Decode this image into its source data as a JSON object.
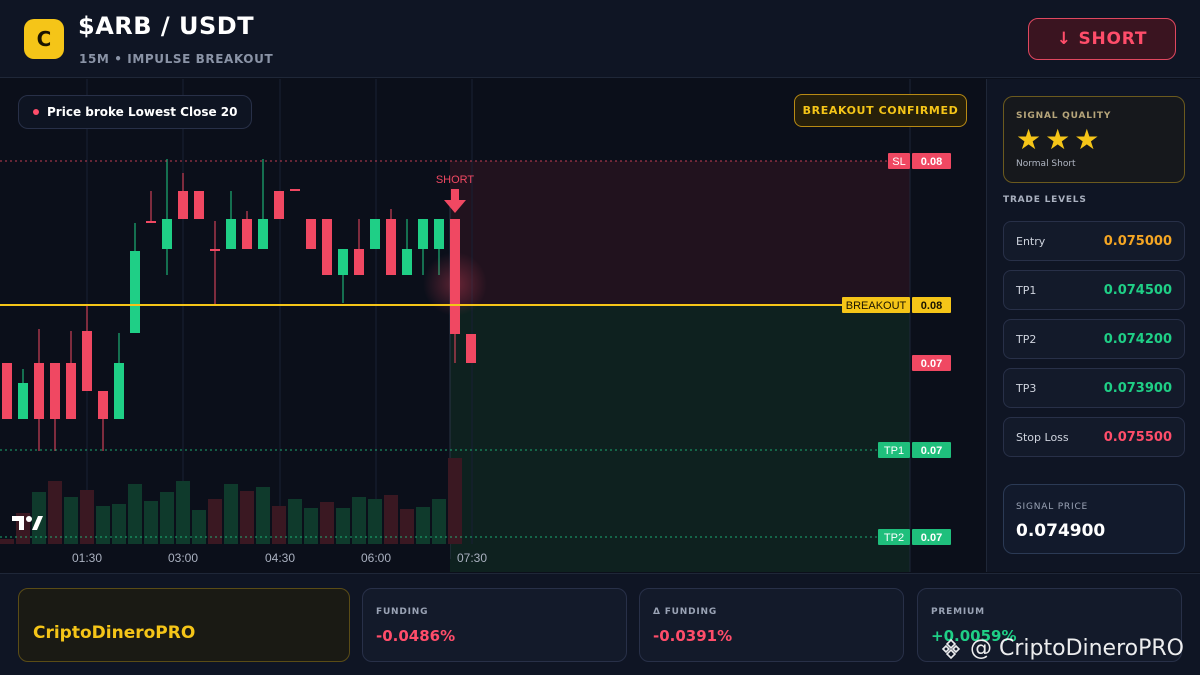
{
  "header": {
    "logo_letter": "C",
    "pair": "$ARB / USDT",
    "subtitle": "15M • IMPULSE BREAKOUT",
    "short_button": "↓ SHORT"
  },
  "chart": {
    "info_pill": "Price broke Lowest Close 20",
    "breakout_pill": "BREAKOUT CONFIRMED",
    "short_marker": "SHORT",
    "tv_logo": "TV",
    "levels": [
      {
        "tag": "SL",
        "value": "0.08",
        "color": "#f04862"
      },
      {
        "tag": "BREAKOUT",
        "value": "0.08",
        "color": "#f5c518"
      },
      {
        "tag": "",
        "value": "0.07",
        "color": "#f04862"
      },
      {
        "tag": "TP1",
        "value": "0.07",
        "color": "#1fbf7c"
      },
      {
        "tag": "TP2",
        "value": "0.07",
        "color": "#1fbf7c"
      }
    ],
    "time_labels": [
      "01:30",
      "03:00",
      "04:30",
      "06:00",
      "07:30"
    ],
    "colors": {
      "up": "#1fcf86",
      "down": "#f04862",
      "breakout": "#f5c518"
    }
  },
  "signal_quality": {
    "title": "SIGNAL QUALITY",
    "stars": "★★★",
    "label": "Normal Short"
  },
  "trade_levels": {
    "title": "TRADE LEVELS",
    "rows": [
      {
        "name": "Entry",
        "value": "0.075000",
        "color": "#f5a623"
      },
      {
        "name": "TP1",
        "value": "0.074500",
        "color": "#1fcf86"
      },
      {
        "name": "TP2",
        "value": "0.074200",
        "color": "#1fcf86"
      },
      {
        "name": "TP3",
        "value": "0.073900",
        "color": "#1fcf86"
      },
      {
        "name": "Stop Loss",
        "value": "0.075500",
        "color": "#ff4d6a"
      }
    ]
  },
  "signal_price": {
    "title": "SIGNAL PRICE",
    "value": "0.074900"
  },
  "footer": {
    "brand": "CriptoDineroPRO",
    "stats": [
      {
        "label": "FUNDING",
        "value": "-0.0486%",
        "color": "#ff4d6a"
      },
      {
        "label": "Δ FUNDING",
        "value": "-0.0391%",
        "color": "#ff4d6a"
      },
      {
        "label": "PREMIUM",
        "value": "+0.0059%",
        "color": "#1fcf86"
      }
    ],
    "watermark": "@ CriptoDineroPRO"
  }
}
